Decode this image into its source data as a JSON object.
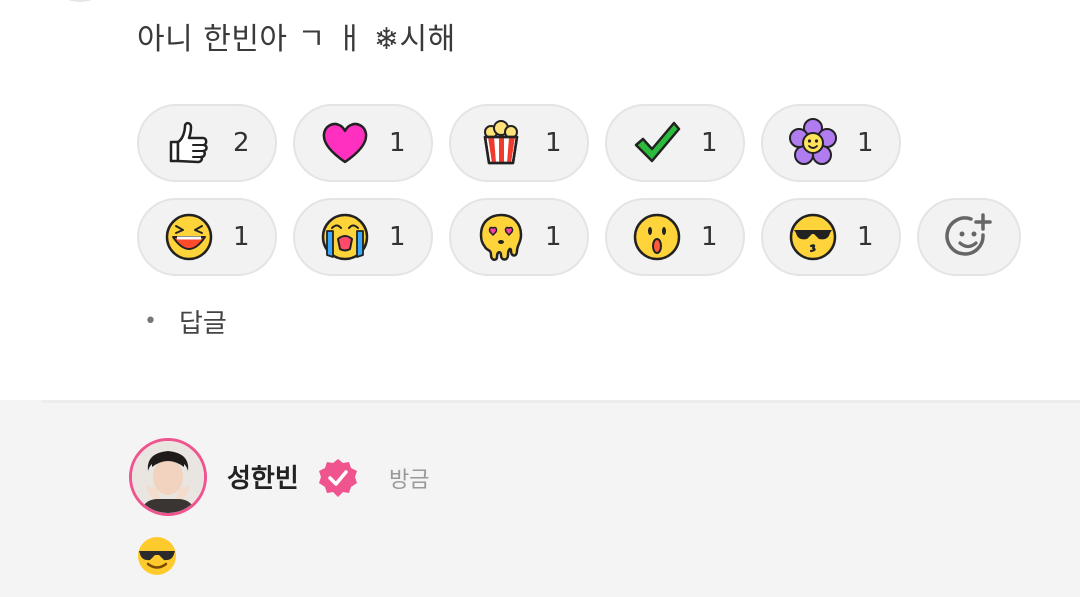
{
  "comment": {
    "text": "아니 한빈아 ㄱ ㅐ ❄시해"
  },
  "reactions": {
    "row1": [
      {
        "icon": "thumbs-up-icon",
        "count": "2"
      },
      {
        "icon": "heart-icon",
        "count": "1"
      },
      {
        "icon": "popcorn-icon",
        "count": "1"
      },
      {
        "icon": "checkmark-icon",
        "count": "1"
      },
      {
        "icon": "flower-icon",
        "count": "1"
      }
    ],
    "row2": [
      {
        "icon": "laughing-face-icon",
        "count": "1"
      },
      {
        "icon": "crying-face-icon",
        "count": "1"
      },
      {
        "icon": "heart-eyes-melting-face-icon",
        "count": "1"
      },
      {
        "icon": "surprised-face-icon",
        "count": "1"
      },
      {
        "icon": "sunglasses-kiss-face-icon",
        "count": "1"
      }
    ],
    "add_icon": "add-reaction-icon"
  },
  "reply_link": "답글",
  "reply": {
    "author": "성한빈",
    "time": "방금",
    "emoji_icon": "smiling-face-with-sunglasses-icon"
  },
  "colors": {
    "verified_badge": "#f0548e",
    "avatar_ring": "#f0548e",
    "pill_background": "#f2f2f2"
  }
}
